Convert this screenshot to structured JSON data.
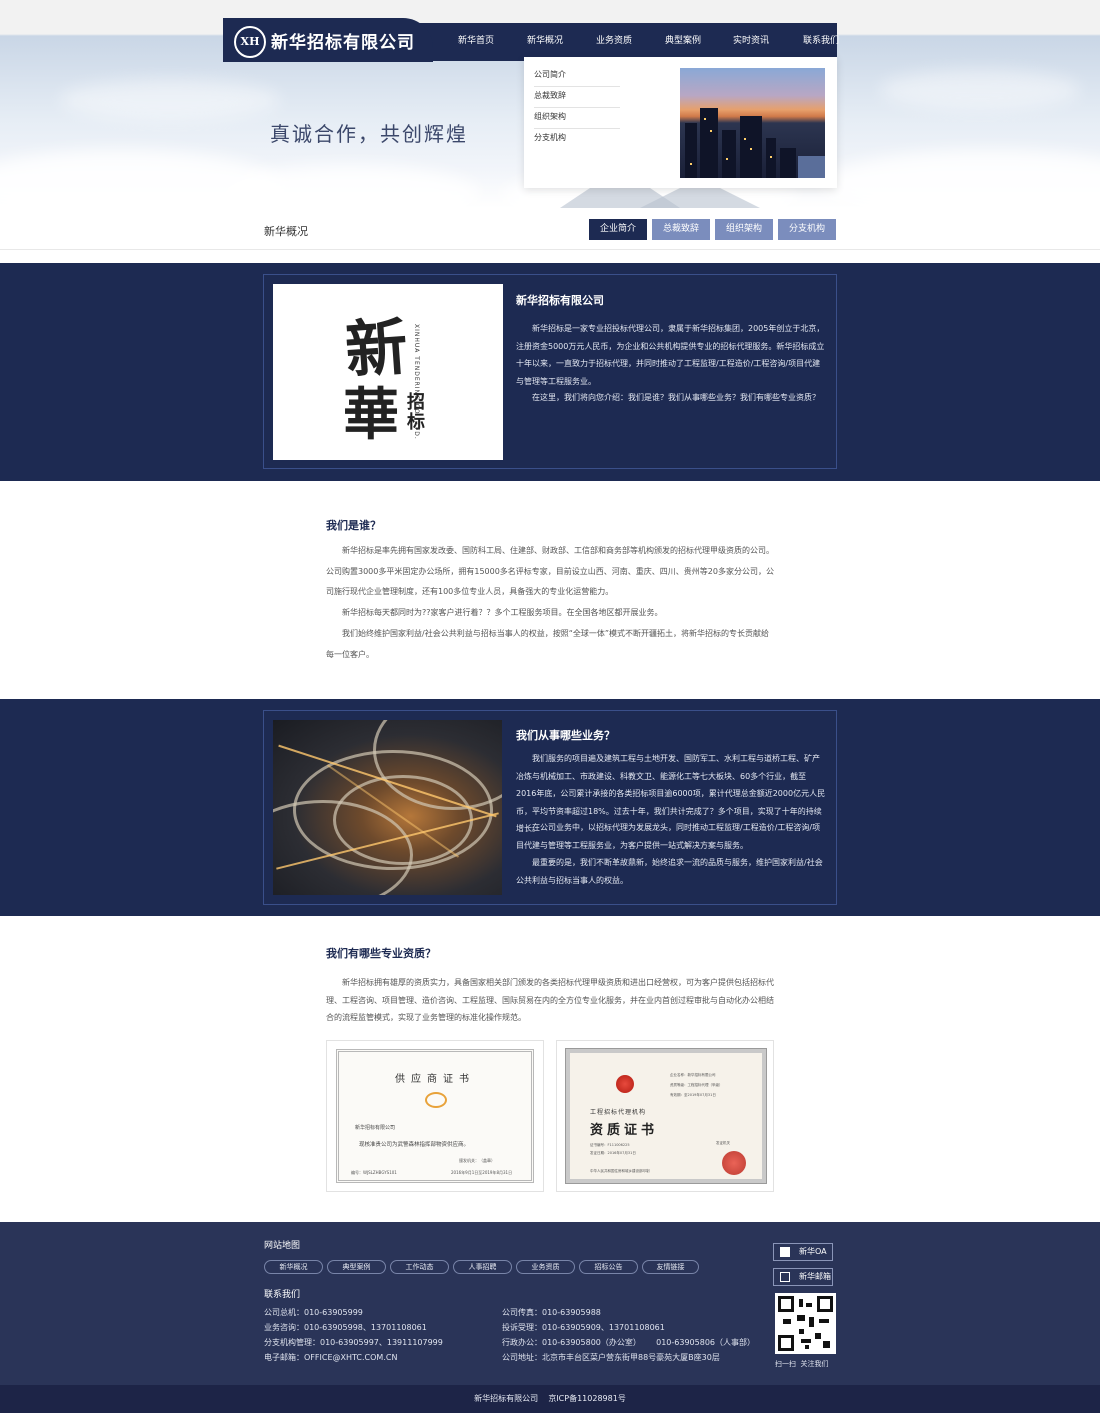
{
  "header": {
    "logo_mark": "XH",
    "brand": "新华招标有限公司",
    "nav": [
      "新华首页",
      "新华概况",
      "业务资质",
      "典型案例",
      "实时资讯",
      "联系我们"
    ],
    "slogan": "真诚合作，共创辉煌",
    "dropdown": [
      "公司简介",
      "总裁致辞",
      "组织架构",
      "分支机构"
    ]
  },
  "subnav": {
    "title": "新华概况",
    "tabs": [
      "企业简介",
      "总裁致辞",
      "组织架构",
      "分支机构"
    ],
    "active_index": 0
  },
  "intro": {
    "logo_big": "新",
    "logo_big2": "華",
    "logo_small": "招标",
    "logo_en": "XINHUA TENDERING CO., LTD.",
    "title": "新华招标有限公司",
    "paragraphs": [
      "新华招标是一家专业招投标代理公司，隶属于新华招标集团，2005年创立于北京，注册资金5000万元人民币，为企业和公共机构提供专业的招标代理服务。新华招标成立十年以来，一直致力于招标代理，并同时推动了工程监理/工程造价/工程咨询/项目代建与管理等工程服务业。",
      "在这里，我们将向您介绍：我们是谁？我们从事哪些业务？我们有哪些专业资质？"
    ]
  },
  "who": {
    "title": "我们是谁？",
    "paragraphs": [
      "新华招标是率先拥有国家发改委、国防科工局、住建部、财政部、工信部和商务部等机构颁发的招标代理甲级资质的公司。公司购置3000多平米固定办公场所，拥有15000多名评标专家，目前设立山西、河南、重庆、四川、贵州等20多家分公司，公司施行现代企业管理制度，还有100多位专业人员，具备强大的专业化运营能力。",
      "新华招标每天都同时为??家客户进行着？？多个工程服务项目。在全国各地区都开展业务。",
      "我们始终维护国家利益/社会公共利益与招标当事人的权益，按照“全球一体”模式不断开疆拓土，将新华招标的专长贡献给每一位客户。"
    ]
  },
  "business": {
    "title": "我们从事哪些业务？",
    "paragraphs": [
      "我们服务的项目遍及建筑工程与土地开发、国防军工、水利工程与道桥工程、矿产冶炼与机械加工、市政建设、科教文卫、能源化工等七大板块、60多个行业，截至2016年底，公司累计承接的各类招标项目逾6000项，累计代理总金额近2000亿元人民币，平均节资率超过18%。过去十年，我们共计完成了？多个项目，实现了十年的持续增长。",
      "在公司业务中，以招标代理为发展龙头，同时推动工程监理/工程造价/工程咨询/项目代建与管理等工程服务业，为客户提供一站式解决方案与服务。",
      "最重要的是，我们不断革故鼎新，始终追求一流的品质与服务，维护国家利益/社会公共利益与招标当事人的权益。"
    ]
  },
  "qualifications": {
    "title": "我们有哪些专业资质？",
    "paragraph": "新华招标拥有雄厚的资质实力，具备国家相关部门颁发的各类招标代理甲级资质和进出口经营权，可为客户提供包括招标代理、工程咨询、项目管理、造价咨询、工程监理、国际贸易在内的全方位专业化服务，并在业内首创过程审批与自动化办公相结合的流程监管模式，实现了业务管理的标准化操作规范。",
    "cert1": {
      "heading": "供应商证书",
      "company": "新华招标有限公司",
      "body": "现核准贵公司为武警森林指挥部物资供应商。",
      "issuer": "颁发机关：（盖章）",
      "serial": "编号：WJSLZHBGYS101",
      "date": "2016年9月1日至2019年8月31日"
    },
    "cert2": {
      "subtitle": "工程招标代理机构",
      "heading": "资质证书",
      "fields": [
        "企业名称：新华招标有限公司",
        "资质等级：工程招标代理（甲级）",
        "有效期：至2019年07月31日"
      ],
      "cert_no": "证书编号：F111006225",
      "issued": "发证日期：2016年07月31日",
      "footer": "中华人民共和国住房和城乡建设部印制",
      "stamp_label": "发证机关"
    }
  },
  "footer": {
    "sitemap_title": "网站地图",
    "sitemap": [
      "新华概况",
      "典型案例",
      "工作动态",
      "人事招聘",
      "业务资质",
      "招标公告",
      "友情链接"
    ],
    "contact_title": "联系我们",
    "contacts_left": [
      "公司总机：010-63905999",
      "业务咨询：010-63905998、13701108061",
      "分支机构管理：010-63905997、13911107999",
      "电子邮箱：OFFICE@XHTC.COM.CN"
    ],
    "contacts_right": [
      "公司传真：010-63905988",
      "投诉受理：010-63905909、13701108061",
      "行政办公：010-63905800（办公室）      010-63905806（人事部）",
      "公司地址：北京市丰台区菜户营东街甲88号豪苑大厦B座30层"
    ],
    "oa_label": "新华OA",
    "mail_label": "新华邮箱",
    "qr_caption": "扫一扫  关注我们",
    "copyright": "新华招标有限公司    京ICP备11028981号"
  }
}
